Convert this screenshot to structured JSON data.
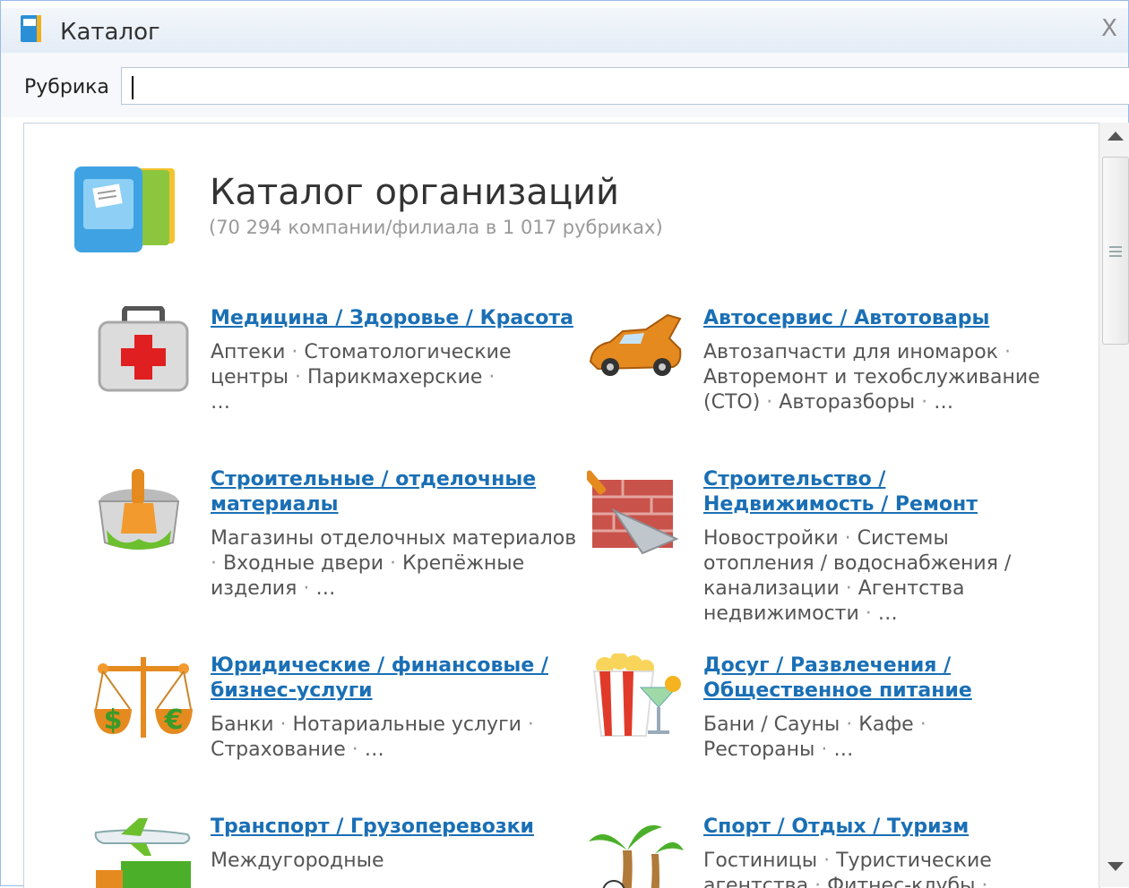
{
  "window": {
    "title": "Каталог",
    "close_label": "X"
  },
  "search": {
    "label": "Рубрика",
    "value": "",
    "placeholder": ""
  },
  "header": {
    "title": "Каталог организаций",
    "subtitle": "(70 294 компании/филиала в 1 017 рубриках)"
  },
  "categories": [
    {
      "title": "Медицина / Здоровье / Красота",
      "subs": [
        "Аптеки",
        "Стоматологические центры",
        "Парикмахерские",
        "…"
      ],
      "icon": "first-aid-kit-icon"
    },
    {
      "title": "Автосервис / Автотовары",
      "subs": [
        "Автозапчасти для иномарок",
        "Авторемонт и техобслуживание (СТО)",
        "Авторазборы",
        "…"
      ],
      "icon": "car-icon"
    },
    {
      "title": "Строительные / отделочные материалы",
      "subs": [
        "Магазины отделочных материалов",
        "Входные двери",
        "Крепёжные изделия",
        "…"
      ],
      "icon": "paint-bucket-icon"
    },
    {
      "title": "Строительство / Недвижимость / Ремонт",
      "subs": [
        "Новостройки",
        "Системы отопления / водоснабжения / канализации",
        "Агентства недвижимости",
        "…"
      ],
      "icon": "brick-trowel-icon"
    },
    {
      "title": "Юридические / финансовые / бизнес-услуги",
      "subs": [
        "Банки",
        "Нотариальные услуги",
        "Страхование",
        "…"
      ],
      "icon": "scales-icon"
    },
    {
      "title": "Досуг / Развлечения / Общественное питание",
      "subs": [
        "Бани / Сауны",
        "Кафе",
        "Рестораны",
        "…"
      ],
      "icon": "popcorn-cocktail-icon"
    },
    {
      "title": "Транспорт / Грузоперевозки",
      "subs": [
        "Междугородные"
      ],
      "icon": "plane-truck-icon"
    },
    {
      "title": "Спорт / Отдых / Туризм",
      "subs": [
        "Гостиницы",
        "Туристические агентства",
        "Фитнес-клубы"
      ],
      "icon": "palm-ball-icon"
    }
  ],
  "colors": {
    "link": "#1a6fb5",
    "subtext": "#555555",
    "muted": "#999999"
  }
}
